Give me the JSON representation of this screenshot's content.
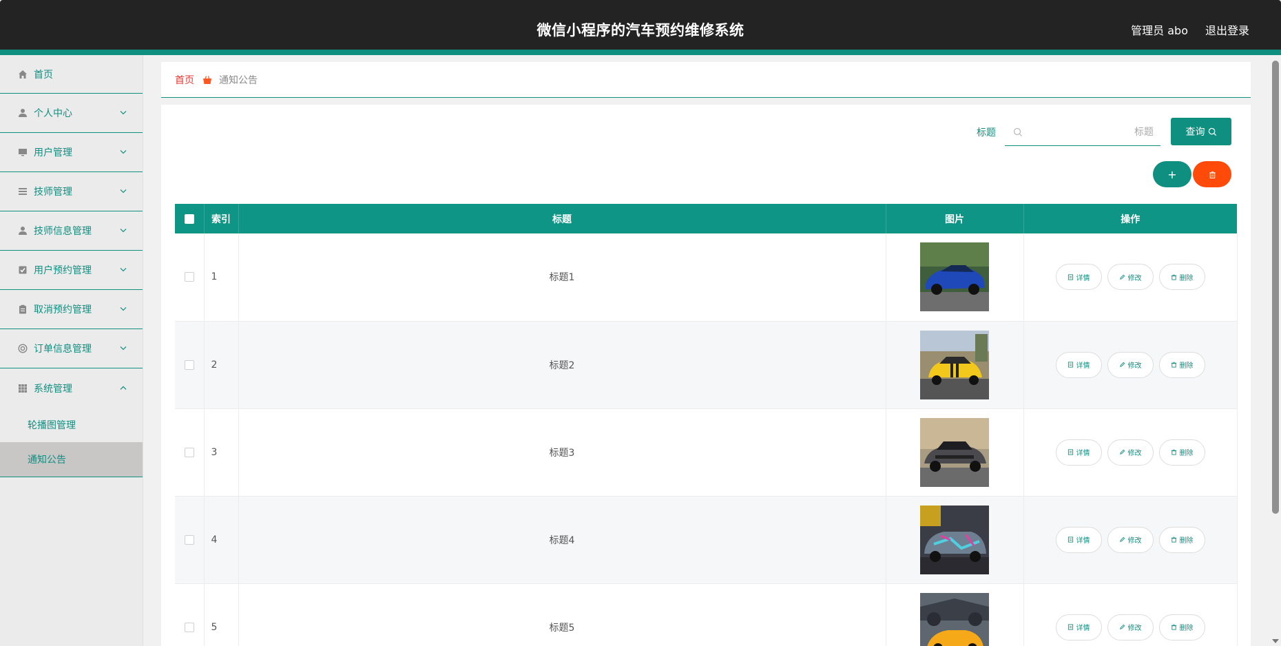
{
  "header": {
    "title": "微信小程序的汽车预约维修系统",
    "user": "管理员 abo",
    "logout": "退出登录"
  },
  "sidebar": {
    "items": [
      {
        "label": "首页",
        "icon": "home-icon"
      },
      {
        "label": "个人中心",
        "icon": "person-icon"
      },
      {
        "label": "用户管理",
        "icon": "monitor-icon"
      },
      {
        "label": "技师管理",
        "icon": "list-icon"
      },
      {
        "label": "技师信息管理",
        "icon": "person-icon"
      },
      {
        "label": "用户预约管理",
        "icon": "checkbox-icon"
      },
      {
        "label": "取消预约管理",
        "icon": "clipboard-icon"
      },
      {
        "label": "订单信息管理",
        "icon": "lifebuoy-icon"
      },
      {
        "label": "系统管理",
        "icon": "grid-icon"
      }
    ],
    "submenu": [
      {
        "label": "轮播图管理"
      },
      {
        "label": "通知公告"
      }
    ]
  },
  "breadcrumb": {
    "home": "首页",
    "current": "通知公告"
  },
  "search": {
    "label": "标题",
    "placeholder": "标题",
    "button": "查询"
  },
  "actions": {
    "add": "+"
  },
  "table": {
    "columns": [
      "索引",
      "标题",
      "图片",
      "操作"
    ],
    "rows": [
      {
        "index": "1",
        "title": "标题1"
      },
      {
        "index": "2",
        "title": "标题2"
      },
      {
        "index": "3",
        "title": "标题3"
      },
      {
        "index": "4",
        "title": "标题4"
      },
      {
        "index": "5",
        "title": "标题5"
      }
    ],
    "row_actions": {
      "detail": "详情",
      "edit": "修改",
      "delete": "删除"
    }
  },
  "colors": {
    "header_bg": "#232323",
    "accent": "#0f8f80",
    "danger": "#ff4a0a",
    "breadcrumb_home": "#e53935"
  }
}
